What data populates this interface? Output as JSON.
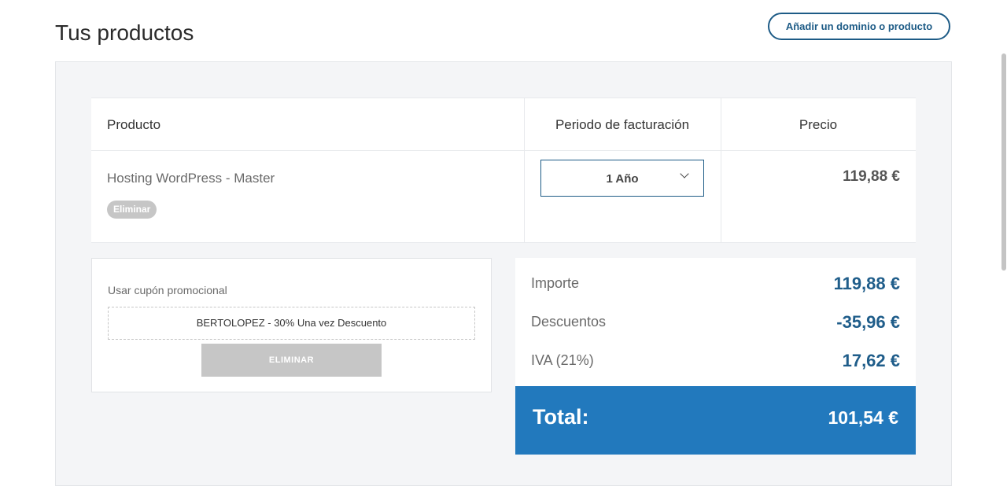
{
  "page": {
    "title": "Tus productos"
  },
  "header": {
    "add_button": "Añadir un dominio o producto"
  },
  "table": {
    "columns": [
      "Producto",
      "Periodo de facturación",
      "Precio"
    ],
    "rows": [
      {
        "product": "Hosting WordPress - Master",
        "remove": "Eliminar",
        "period": "1 Año",
        "price": "119,88 €"
      }
    ]
  },
  "coupon": {
    "label": "Usar cupón promocional",
    "code": "BERTOLOPEZ - 30% Una vez Descuento",
    "remove_button": "ELIMINAR"
  },
  "summary": {
    "items": [
      {
        "label": "Importe",
        "value": "119,88 €"
      },
      {
        "label": "Descuentos",
        "value": "-35,96 €"
      },
      {
        "label": "IVA (21%)",
        "value": "17,62 €"
      }
    ],
    "total_label": "Total:",
    "total_value": "101,54 €"
  },
  "colors": {
    "accent": "#1d5b86",
    "total_bar": "#2279bd",
    "panel_bg": "#f4f5f7",
    "disabled_gray": "#c6c6c6"
  },
  "icons": {
    "period_dropdown": "chevron-down-icon"
  }
}
